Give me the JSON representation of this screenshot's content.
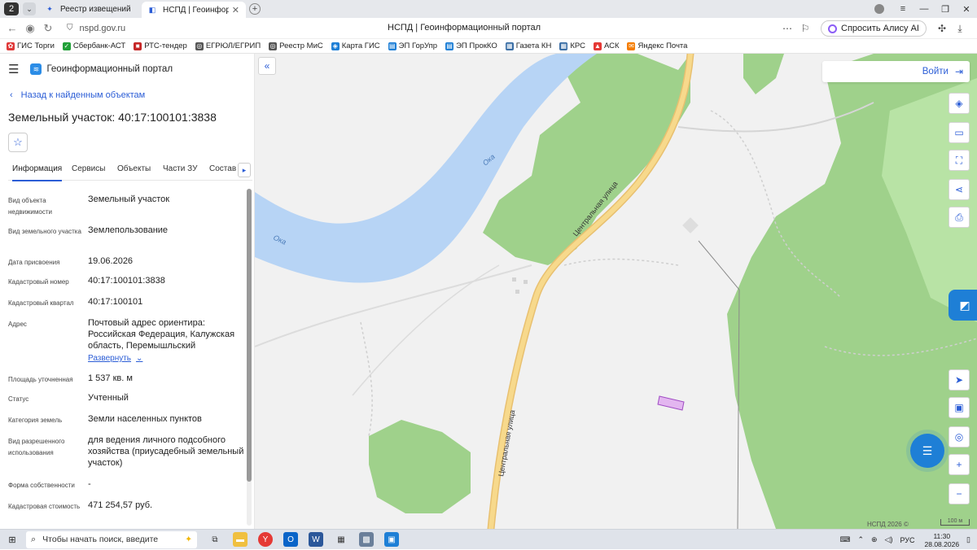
{
  "browser": {
    "tab_count": "2",
    "tabs": [
      {
        "label": "Реестр извещений",
        "active": false
      },
      {
        "label": "НСПД | Геоинформацио",
        "active": true
      }
    ],
    "url": "nspd.gov.ru",
    "page_title": "НСПД | Геоинформационный портал",
    "alice_label": "Спросить Алису AI",
    "bookmarks": [
      "ГИС Торги",
      "Сбербанк-АСТ",
      "РТС-тендер",
      "ЕГРЮЛ/ЕГРИП",
      "Реестр МиС",
      "Карта ГИС",
      "ЭП ГорУпр",
      "ЭП ПрокКО",
      "Газета КН",
      "КРС",
      "АСК",
      "Яндекс Почта"
    ]
  },
  "sidebar": {
    "portal_title": "Геоинформационный портал",
    "back_label": "Назад к найденным объектам",
    "object_title": "Земельный участок: 40:17:100101:3838",
    "tabs": [
      "Информация",
      "Сервисы",
      "Объекты",
      "Части ЗУ",
      "Состав"
    ],
    "properties": [
      {
        "label": "Вид объекта недвижимости",
        "value": "Земельный участок"
      },
      {
        "label": "Вид земельного участка",
        "value": "Землепользование"
      },
      {
        "label": "Дата присвоения",
        "value": "19.06.2026"
      },
      {
        "label": "Кадастровый номер",
        "value": "40:17:100101:3838"
      },
      {
        "label": "Кадастровый квартал",
        "value": "40:17:100101"
      },
      {
        "label": "Адрес",
        "value": "Почтовый адрес ориентира: Российская Федерация, Калужская область, Перемышльский",
        "action": "Развернуть"
      },
      {
        "label": "Площадь уточненная",
        "value": "1 537 кв. м"
      },
      {
        "label": "Статус",
        "value": "Учтенный"
      },
      {
        "label": "Категория земель",
        "value": "Земли населенных пунктов"
      },
      {
        "label": "Вид разрешенного использования",
        "value": "для ведения личного подсобного хозяйства (приусадебный земельный участок)"
      },
      {
        "label": "Форма собственности",
        "value": "-"
      },
      {
        "label": "Кадастровая стоимость",
        "value": "471 254,57 руб."
      }
    ]
  },
  "map": {
    "login_label": "Войти",
    "labels": {
      "river_1": "Ока",
      "river_2": "Ока",
      "street_1": "Центральная улица",
      "street_2": "Центральная улица"
    },
    "copyright": "НСПД 2026 ©",
    "scale": "100 м",
    "colors": {
      "water": "#b7d4f5",
      "forest": "#9fd18b",
      "road": "#f2c96b",
      "parcel": "#c98be6"
    }
  },
  "taskbar": {
    "search_placeholder": "Чтобы начать поиск, введите",
    "language": "РУС",
    "time": "11:30",
    "date": "28.08.2026"
  }
}
